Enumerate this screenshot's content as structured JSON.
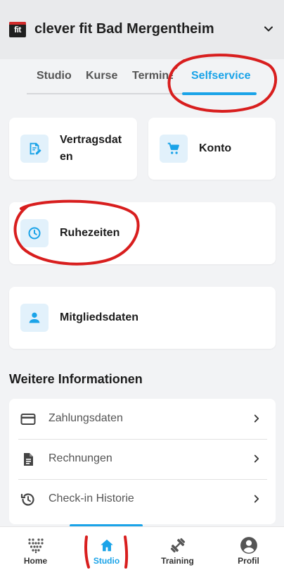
{
  "header": {
    "logo_text": "fit",
    "gym_name": "clever fit Bad Mergentheim",
    "chevron_icon": "chevron-down-icon"
  },
  "tabs": [
    {
      "label": "Studio"
    },
    {
      "label": "Kurse"
    },
    {
      "label": "Termine"
    },
    {
      "label": "Selfservice",
      "active": true
    }
  ],
  "cards": {
    "vertragsdaten": {
      "label_line1": "Vertragsdat",
      "label_line2": "en",
      "icon": "edit-document-icon"
    },
    "konto": {
      "label": "Konto",
      "icon": "cart-icon"
    },
    "ruhezeiten": {
      "label": "Ruhezeiten",
      "icon": "clock-icon"
    },
    "mitgliedsdaten": {
      "label": "Mitgliedsdaten",
      "icon": "person-icon"
    }
  },
  "more_info": {
    "title": "Weitere Informationen",
    "items": [
      {
        "label": "Zahlungsdaten",
        "icon": "credit-card-icon"
      },
      {
        "label": "Rechnungen",
        "icon": "document-icon"
      },
      {
        "label": "Check-in Historie",
        "icon": "history-icon"
      }
    ]
  },
  "bottom_nav": [
    {
      "label": "Home",
      "icon": "dots-logo-icon"
    },
    {
      "label": "Studio",
      "icon": "home-icon",
      "active": true
    },
    {
      "label": "Training",
      "icon": "dumbbell-icon"
    },
    {
      "label": "Profil",
      "icon": "account-circle-icon"
    }
  ],
  "colors": {
    "accent": "#1aa3e8",
    "annotation": "#d81e1e",
    "background": "#f2f3f5"
  }
}
